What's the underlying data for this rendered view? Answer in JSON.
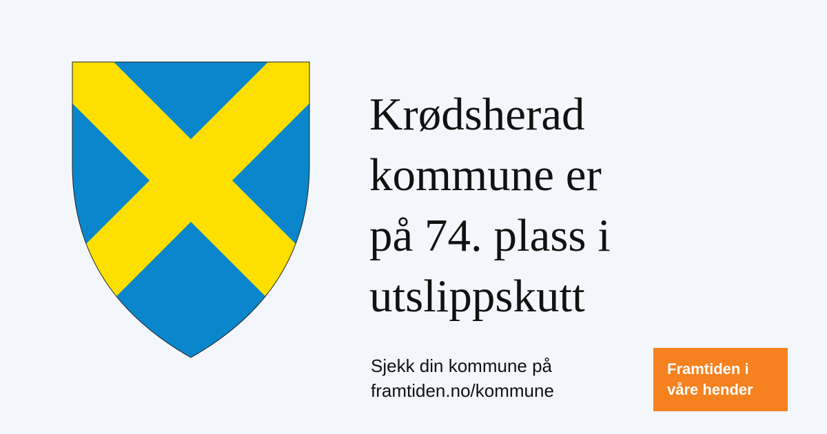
{
  "coat_of_arms": {
    "field_color": "#0a86cc",
    "saltire_color": "#fddf00"
  },
  "headline": {
    "lines": [
      "Krødsherad",
      "kommune er",
      "på 74. plass i",
      "utslippskutt"
    ]
  },
  "cta": {
    "line1": "Sjekk din kommune på",
    "line2": "framtiden.no/kommune"
  },
  "badge": {
    "line1": "Framtiden i",
    "line2": "våre hender",
    "color": "#f5821f"
  }
}
